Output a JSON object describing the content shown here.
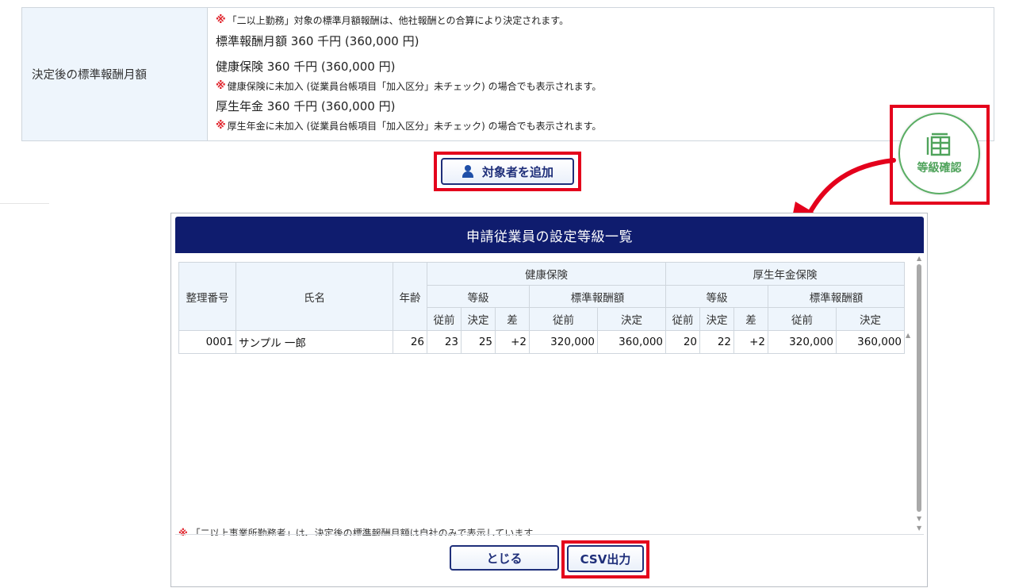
{
  "info": {
    "label": "決定後の標準報酬月額",
    "note_top": "「二以上勤務」対象の標準月額報酬は、他社報酬との合算により決定されます。",
    "monthly": "標準報酬月額 360 千円 (360,000 円)",
    "health": "健康保険 360 千円 (360,000 円)",
    "health_note": "健康保険に未加入 (従業員台帳項目「加入区分」未チェック) の場合でも表示されます。",
    "pension": "厚生年金 360 千円 (360,000 円)",
    "pension_note": "厚生年金に未加入 (従業員台帳項目「加入区分」未チェック) の場合でも表示されます。",
    "note_mark": "※"
  },
  "add_button": {
    "label": "対象者を追加",
    "icon": "person-icon"
  },
  "grade_button": {
    "label": "等級確認",
    "icon": "grade-table-icon",
    "color": "#4fa35b"
  },
  "dialog": {
    "title": "申請従業員の設定等級一覧",
    "headers": {
      "no": "整理番号",
      "name": "氏名",
      "age": "年齢",
      "health": "健康保険",
      "pension": "厚生年金保険",
      "grade": "等級",
      "std": "標準報酬額",
      "before": "従前",
      "decided": "決定",
      "diff": "差"
    },
    "rows": [
      {
        "no": "0001",
        "name": "サンプル 一郎",
        "age": "26",
        "h_grade_before": "23",
        "h_grade_decided": "25",
        "h_grade_diff": "+2",
        "h_std_before": "320,000",
        "h_std_decided": "360,000",
        "p_grade_before": "20",
        "p_grade_decided": "22",
        "p_grade_diff": "+2",
        "p_std_before": "320,000",
        "p_std_decided": "360,000"
      }
    ],
    "footnote_mark": "※",
    "footnote": "「二以上事業所勤務者」は、決定後の標準報酬月額は自社のみで表示しています",
    "close_label": "とじる",
    "csv_label": "CSV出力"
  },
  "colors": {
    "header_navy": "#0f1c6e",
    "highlight_red": "#e4001c",
    "table_header_bg": "#eef5fc",
    "note_red": "#e0242c"
  }
}
